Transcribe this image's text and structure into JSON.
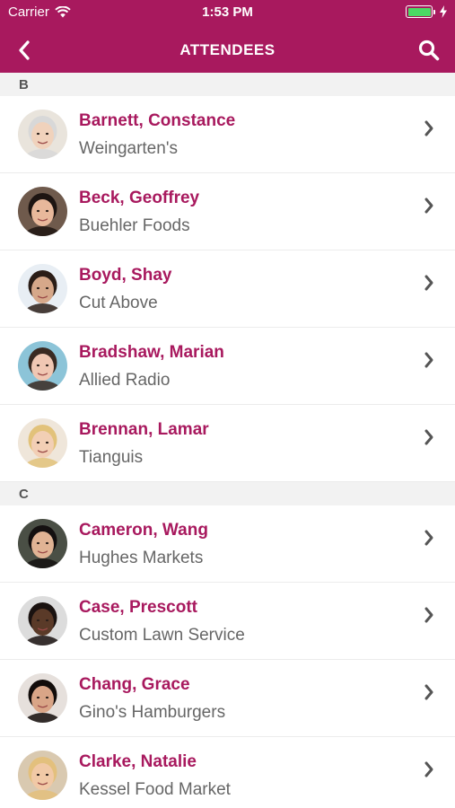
{
  "status_bar": {
    "carrier": "Carrier",
    "time": "1:53 PM",
    "battery_level": 1.0
  },
  "navbar": {
    "title": "ATTENDEES",
    "back_icon": "chevron-left-icon",
    "search_icon": "search-icon"
  },
  "colors": {
    "brand": "#a8195e",
    "section_bg": "#f2f2f2",
    "company_text": "#666666",
    "battery": "#4cd964"
  },
  "sections": [
    {
      "letter": "B",
      "rows": [
        {
          "name": "Barnett, Constance",
          "company": "Weingarten's",
          "avatar": {
            "bg": "#e9e4dc",
            "skin": "#f0d2bc",
            "hair": "#d8d8d8"
          }
        },
        {
          "name": "Beck, Geoffrey",
          "company": "Buehler Foods",
          "avatar": {
            "bg": "#6f5a4c",
            "skin": "#e8b89b",
            "hair": "#1e1512"
          }
        },
        {
          "name": "Boyd, Shay",
          "company": "Cut Above",
          "avatar": {
            "bg": "#e8eef4",
            "skin": "#d6a88a",
            "hair": "#2a1d17"
          }
        },
        {
          "name": "Bradshaw, Marian",
          "company": "Allied Radio",
          "avatar": {
            "bg": "#8cc4d8",
            "skin": "#f0c7b3",
            "hair": "#3a2a22"
          }
        },
        {
          "name": "Brennan, Lamar",
          "company": "Tianguis",
          "avatar": {
            "bg": "#efe6da",
            "skin": "#f2cfb5",
            "hair": "#e2c27a"
          }
        }
      ]
    },
    {
      "letter": "C",
      "rows": [
        {
          "name": "Cameron, Wang",
          "company": "Hughes Markets",
          "avatar": {
            "bg": "#4a4f45",
            "skin": "#e0b394",
            "hair": "#141010"
          }
        },
        {
          "name": "Case, Prescott",
          "company": "Custom Lawn Service",
          "avatar": {
            "bg": "#dcdcdc",
            "skin": "#5a3a28",
            "hair": "#1a1210"
          }
        },
        {
          "name": "Chang, Grace",
          "company": "Gino's Hamburgers",
          "avatar": {
            "bg": "#e6e0dc",
            "skin": "#d9a587",
            "hair": "#120c0a"
          }
        },
        {
          "name": "Clarke, Natalie",
          "company": "Kessel Food Market",
          "avatar": {
            "bg": "#d9c9b0",
            "skin": "#f1c9a6",
            "hair": "#e3c07d"
          }
        }
      ]
    }
  ]
}
